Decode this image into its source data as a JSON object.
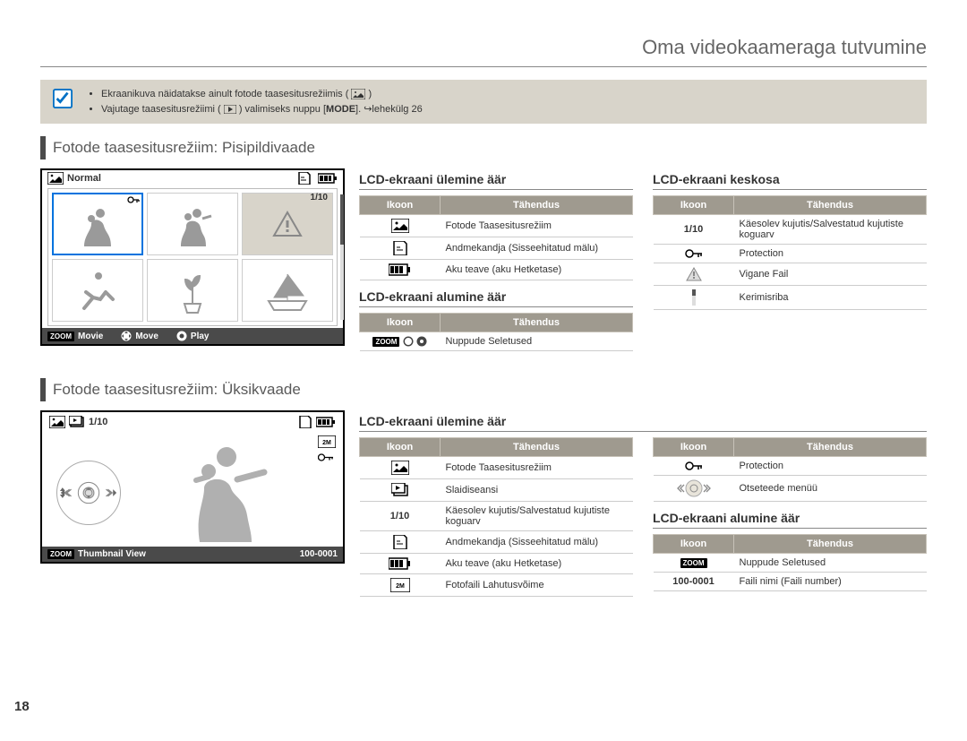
{
  "header": {
    "title": "Oma videokaameraga tutvumine"
  },
  "note": {
    "bullet1_pre": "Ekraanikuva näidatakse ainult fotode taasesitusrežiimis (",
    "bullet1_post": ")",
    "bullet2_pre": "Vajutage taasesitusrežiimi (",
    "bullet2_mid": ") valimiseks nuppu [",
    "bullet2_mode": "MODE",
    "bullet2_end": "]. ↪lehekülg 26"
  },
  "sections": {
    "thumbnail": "Fotode taasesitusrežiim: Pisipildivaade",
    "single": "Fotode taasesitusrežiim: Üksikvaade"
  },
  "lcd_thumb": {
    "title_icon_text": "Normal",
    "counter": "1/10",
    "footer": {
      "movie": "Movie",
      "move": "Move",
      "play": "Play"
    }
  },
  "lcd_single": {
    "counter": "1/10",
    "footer_left": "Thumbnail View",
    "footer_right": "100-0001"
  },
  "headings": {
    "top": "LCD-ekraani ülemine äär",
    "center": "LCD-ekraani keskosa",
    "bottom": "LCD-ekraani alumine äär"
  },
  "table_headers": {
    "icon": "Ikoon",
    "meaning": "Tähendus"
  },
  "thumb_top_table": [
    {
      "icon": "photo-play",
      "text": "Fotode Taasesitusrežiim"
    },
    {
      "icon": "storage",
      "text": "Andmekandja (Sisseehitatud mälu)"
    },
    {
      "icon": "battery",
      "text": "Aku teave (aku Hetketase)"
    }
  ],
  "thumb_center_table": [
    {
      "icon": "1/10",
      "text": "Käesolev kujutis/Salvestatud kujutiste koguarv"
    },
    {
      "icon": "key",
      "text": "Protection"
    },
    {
      "icon": "warn",
      "text": "Vigane Fail"
    },
    {
      "icon": "scroll",
      "text": "Kerimisriba"
    }
  ],
  "thumb_bottom_table": [
    {
      "icon": "zoom-nav",
      "text": "Nuppude Seletused"
    }
  ],
  "single_left_table": [
    {
      "icon": "photo-play",
      "text": "Fotode Taasesitusrežiim"
    },
    {
      "icon": "slideshow",
      "text": "Slaidiseansi"
    },
    {
      "icon": "1/10",
      "text": "Käesolev kujutis/Salvestatud kujutiste koguarv"
    },
    {
      "icon": "storage",
      "text": "Andmekandja (Sisseehitatud mälu)"
    },
    {
      "icon": "battery",
      "text": "Aku teave (aku Hetketase)"
    },
    {
      "icon": "resolution",
      "text": "Fotofaili Lahutusvõime"
    }
  ],
  "single_right_top_table": [
    {
      "icon": "key",
      "text": "Protection"
    },
    {
      "icon": "dial",
      "text": "Otseteede menüü"
    }
  ],
  "single_right_bottom_table": [
    {
      "icon": "zoom-only",
      "text": "Nuppude Seletused"
    },
    {
      "icon": "100-0001",
      "text": "Faili nimi (Faili number)"
    }
  ],
  "page_number": "18"
}
